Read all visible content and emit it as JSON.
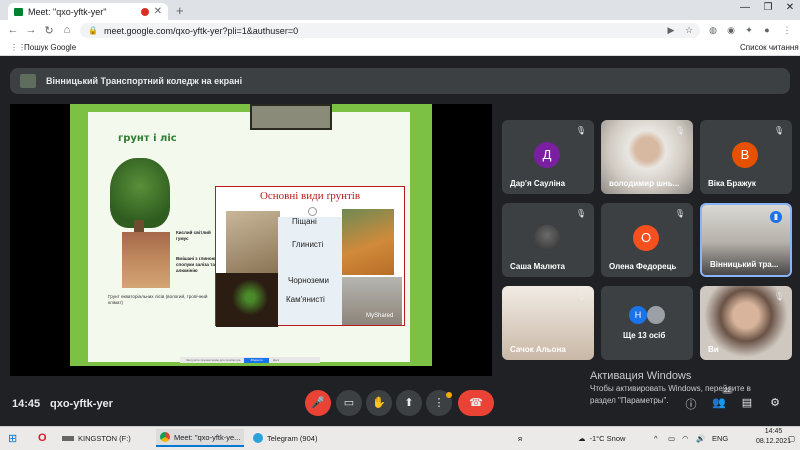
{
  "browser": {
    "tab_title": "Meet: \"qxo-yftk-yer\"",
    "url": "meet.google.com/qxo-yftk-yer?pli=1&authuser=0",
    "bookmark_left": "Пошук Google",
    "bookmark_right": "Список читання"
  },
  "presenter": {
    "label": "Вінницький Транспортний коледж на екрані"
  },
  "slide": {
    "title": "грунт і ліс",
    "types_title": "Основні види ґрунтів",
    "types": [
      "Піщані",
      "Глинисті",
      "Чорноземи",
      "Кам'янисті"
    ],
    "soil_labels": [
      "Кислий світлий гумус",
      "Вмішані з глиною сполуки заліза та алюмінію"
    ],
    "caption": "Грунт екваторіальних лісів (вологий, тропічний клімат)",
    "watermark": "MyShared",
    "footer_text": "Загрузите презентацию для просмотра",
    "footer_button": "Зберегти",
    "footer_link": "Далі"
  },
  "participants": [
    {
      "name": "Дар'я Сауліна",
      "initial": "Д",
      "color": "#7b1fa2"
    },
    {
      "name": "володимир шнь...",
      "initial": "",
      "color": ""
    },
    {
      "name": "Віка Бражук",
      "initial": "В",
      "color": "#e65100"
    },
    {
      "name": "Саша Малюта",
      "initial": "",
      "color": ""
    },
    {
      "name": "Олена Федорець",
      "initial": "О",
      "color": "#f4511e"
    },
    {
      "name": "Вінницький тра...",
      "initial": "",
      "color": ""
    },
    {
      "name": "Сачок Альона",
      "initial": "",
      "color": ""
    },
    {
      "name": "Ще 13 осіб",
      "initial": "Н",
      "color": "#1a73e8"
    },
    {
      "name": "Ви",
      "initial": "",
      "color": ""
    }
  ],
  "bottom": {
    "time": "14:45",
    "meeting_code": "qxo-yftk-yer",
    "activate_title": "Активация Windows",
    "activate_sub1": "Чтобы активировать Windows, перейдите в",
    "activate_sub2": "раздел \"Параметры\".",
    "people_count": "22"
  },
  "taskbar": {
    "drive": "KINGSTON (F:)",
    "chrome": "Meet: \"qxo-yftk-ye...",
    "telegram": "Telegram (904)",
    "temperature": "-1°C  Snow",
    "language": "ENG",
    "time": "14:45",
    "date": "08.12.2021"
  }
}
